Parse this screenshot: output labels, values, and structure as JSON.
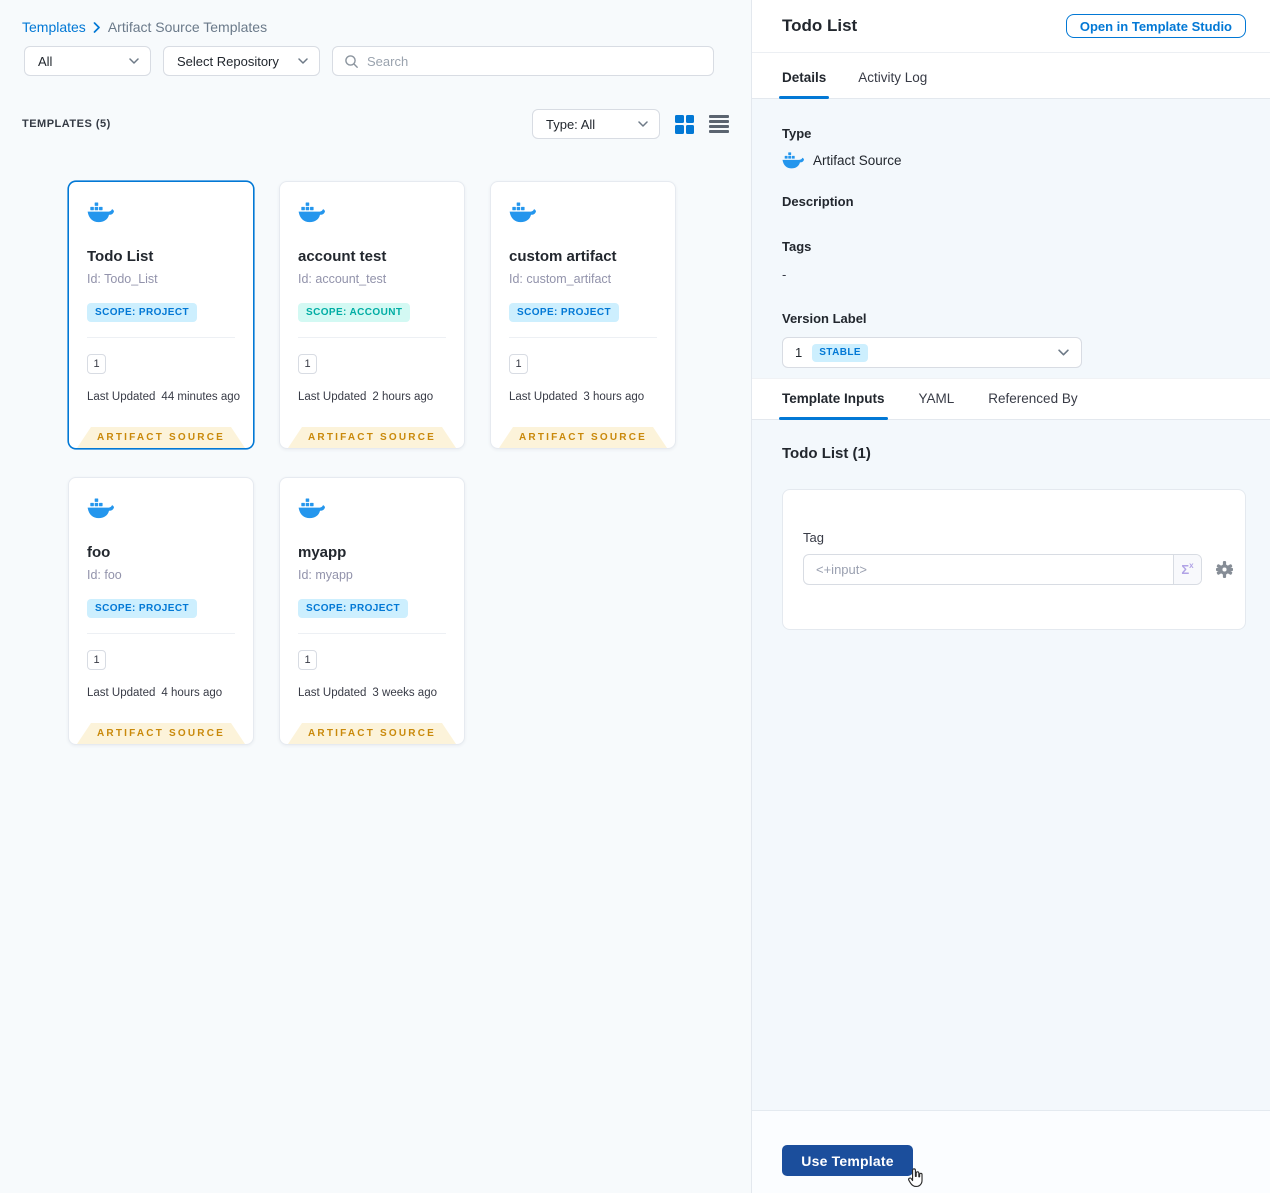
{
  "breadcrumb": {
    "link": "Templates",
    "current": "Artifact Source Templates"
  },
  "filters": {
    "scope": "All",
    "repository": "Select Repository",
    "search_placeholder": "Search",
    "count": "TEMPLATES (5)",
    "type": "Type: All"
  },
  "labels": {
    "last_updated": "Last Updated",
    "ribbon": "ARTIFACT SOURCE"
  },
  "cards": [
    {
      "title": "Todo List",
      "id": "Id: Todo_List",
      "scope": "SCOPE: PROJECT",
      "version": "1",
      "updated": "44 minutes ago"
    },
    {
      "title": "account test",
      "id": "Id: account_test",
      "scope": "SCOPE: ACCOUNT",
      "version": "1",
      "updated": "2 hours ago"
    },
    {
      "title": "custom artifact",
      "id": "Id: custom_artifact",
      "scope": "SCOPE: PROJECT",
      "version": "1",
      "updated": "3 hours ago"
    },
    {
      "title": "foo",
      "id": "Id: foo",
      "scope": "SCOPE: PROJECT",
      "version": "1",
      "updated": "4 hours ago"
    },
    {
      "title": "myapp",
      "id": "Id: myapp",
      "scope": "SCOPE: PROJECT",
      "version": "1",
      "updated": "3 weeks ago"
    }
  ],
  "panel": {
    "title": "Todo List",
    "open_button": "Open in Template Studio",
    "tabs": {
      "details": "Details",
      "activity_log": "Activity Log"
    },
    "details": {
      "type_label": "Type",
      "type_value": "Artifact Source",
      "description_label": "Description",
      "tags_label": "Tags",
      "tags_value": "-",
      "version_label": "Version Label",
      "version_number": "1",
      "version_badge": "STABLE"
    },
    "sub_tabs": {
      "template_inputs": "Template Inputs",
      "yaml": "YAML",
      "referenced_by": "Referenced By"
    },
    "inputs": {
      "section_title": "Todo List (1)",
      "tag_label": "Tag",
      "tag_value": "<+input>",
      "sigma": "Σ",
      "sigma_sup": "x"
    },
    "use_button": "Use Template"
  },
  "colors": {
    "primary_blue": "#0278d5",
    "docker_blue": "#2496ed",
    "scope_project_text": "#0278d5",
    "scope_project_bg": "#cdeffe",
    "scope_account_text": "#00ada4",
    "scope_account_bg": "#d3f9f3",
    "ribbon_text": "#c9890b",
    "ribbon_bg": "#fcf3da",
    "stable_text": "#0278d5",
    "stable_bg": "#cdeffe",
    "use_button_bg": "#1b4e9c"
  }
}
